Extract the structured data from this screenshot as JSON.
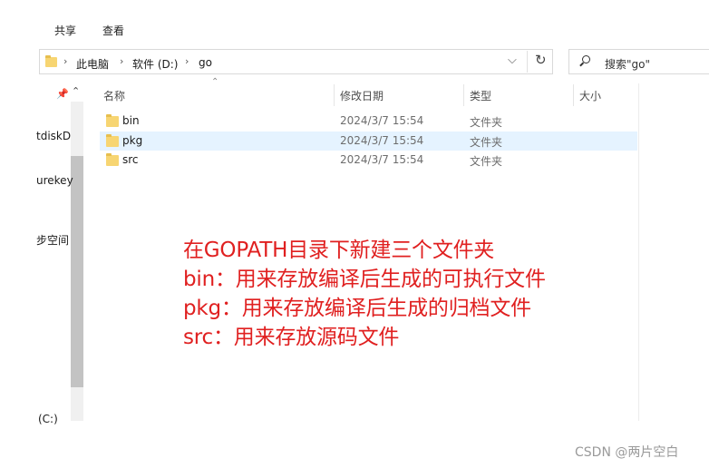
{
  "ribbon": {
    "tabs": [
      "共享",
      "查看"
    ]
  },
  "address_bar": {
    "breadcrumbs": [
      "此电脑",
      "软件 (D:)",
      "go"
    ],
    "chevron": "›",
    "dropdown_glyph": "⌵",
    "refresh_glyph": "↻"
  },
  "search": {
    "placeholder": "搜索\"go\""
  },
  "nav_pane": {
    "items": [
      "tdiskD",
      "urekey",
      "步空间",
      "(C:)"
    ],
    "pin_glyph": "📌",
    "scroll_up_glyph": "⌃"
  },
  "columns": {
    "name": "名称",
    "date": "修改日期",
    "type": "类型",
    "size": "大小",
    "sort_glyph": "⌃"
  },
  "files": [
    {
      "name": "bin",
      "date": "2024/3/7 15:54",
      "type": "文件夹"
    },
    {
      "name": "pkg",
      "date": "2024/3/7 15:54",
      "type": "文件夹"
    },
    {
      "name": "src",
      "date": "2024/3/7 15:54",
      "type": "文件夹"
    }
  ],
  "annotation": {
    "lines": [
      "在GOPATH目录下新建三个文件夹",
      "bin：用来存放编译后生成的可执行文件",
      "pkg：用来存放编译后生成的归档文件",
      "src：用来存放源码文件"
    ],
    "color": "#e02020"
  },
  "watermark": "CSDN @两片空白",
  "colors": {
    "selected_row": "#e5f3ff",
    "folder": "#f7d572"
  }
}
